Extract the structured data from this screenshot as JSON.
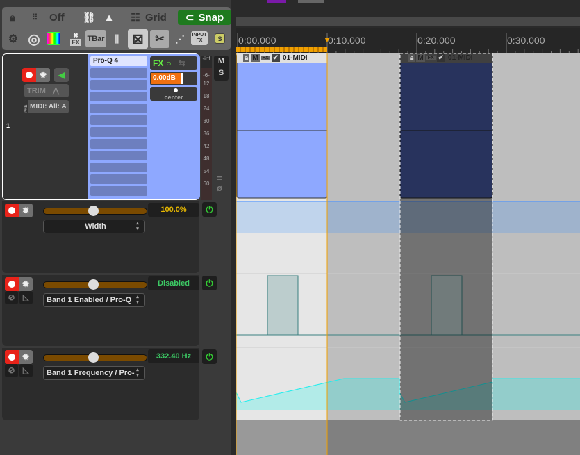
{
  "toolbar": {
    "snap_off_label": "Off",
    "grid_label": "Grid",
    "snap_label": "Snap",
    "tbar_label": "TBar",
    "input_fx_label": "INPUT FX",
    "fx_label": "FX",
    "s_label": "S"
  },
  "track": {
    "number": "1",
    "trim_label": "TRIM",
    "midi_input": "MIDI: All: A",
    "pre_label": "PRE",
    "fx_slots": [
      "Pro-Q 4",
      "",
      "",
      "",
      "",
      "",
      "",
      "",
      "",
      "",
      "",
      ""
    ],
    "fx_button": "FX",
    "volume": "0.00dB",
    "pan": "center",
    "meter_labels": [
      "-inf",
      "-6-",
      "12",
      "18",
      "24",
      "30",
      "36",
      "42",
      "48",
      "54",
      "60"
    ],
    "mute": "M",
    "solo": "S"
  },
  "envelopes": [
    {
      "value": "100.0%",
      "value_color": "#e8b800",
      "param": "Width",
      "slider": 0.5
    },
    {
      "value": "Disabled",
      "value_color": "#3cc864",
      "param": "Band 1 Enabled / Pro-Q",
      "slider": 0.5
    },
    {
      "value": "332.40 Hz",
      "value_color": "#3cc864",
      "param": "Band 1 Frequency / Pro-",
      "slider": 0.5
    }
  ],
  "ruler": {
    "labels": [
      "0:00.000",
      "0:10.000",
      "0:20.000",
      "0:30.000"
    ]
  },
  "items": [
    {
      "name": "01-MIDI",
      "flags": [
        "M",
        "FX"
      ]
    },
    {
      "name": "01-MIDI",
      "flags": [
        "M",
        "FX"
      ]
    }
  ]
}
